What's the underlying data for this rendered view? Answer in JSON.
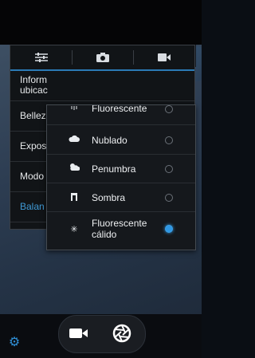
{
  "colors": {
    "accent": "#2f97e3",
    "panel_bg": "#111417",
    "popup_bg": "#15181c",
    "text": "#eef0f2"
  },
  "tabs": [
    {
      "name": "tab-settings",
      "icon": "sliders-icon"
    },
    {
      "name": "tab-camera",
      "icon": "camera-icon"
    },
    {
      "name": "tab-video",
      "icon": "video-icon"
    }
  ],
  "settings": {
    "items": [
      {
        "label_line1": "Inform",
        "label_line2": "ubicac"
      },
      {
        "label": "Bellez"
      },
      {
        "label": "Expos"
      },
      {
        "label": "Modo"
      },
      {
        "label": "Balan"
      }
    ]
  },
  "white_balance": {
    "options": [
      {
        "label": "Fluorescente",
        "icon": "fluorescent-icon",
        "selected": false
      },
      {
        "label": "Nublado",
        "icon": "cloud-icon",
        "selected": false
      },
      {
        "label": "Penumbra",
        "icon": "twilight-icon",
        "selected": false
      },
      {
        "label": "Sombra",
        "icon": "shade-icon",
        "selected": false
      },
      {
        "label_line1": "Fluorescente",
        "label_line2": "cálido",
        "icon": "warm-fluorescent-icon",
        "selected": true
      }
    ]
  },
  "bottom": {
    "video_icon": "video-camera-icon",
    "shutter_icon": "shutter-icon",
    "settings_icon": "gear-icon"
  }
}
